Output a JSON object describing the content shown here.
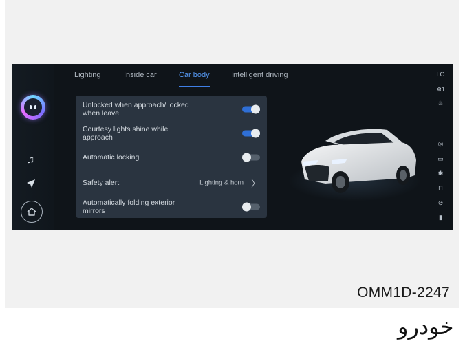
{
  "tabs": [
    {
      "label": "Lighting"
    },
    {
      "label": "Inside car"
    },
    {
      "label": "Car body"
    },
    {
      "label": "Intelligent driving"
    }
  ],
  "settings": [
    {
      "label": "Unlocked when approach/ locked when leave",
      "state": "on"
    },
    {
      "label": "Courtesy lights shine while approach",
      "state": "on"
    },
    {
      "label": "Automatic locking",
      "state": "off"
    },
    {
      "label": "Safety alert",
      "value": "Lighting & horn"
    },
    {
      "label": "Automatically folding exterior mirrors",
      "state": "off"
    }
  ],
  "right_rail": {
    "lo": "LO",
    "fan_speed": "1"
  },
  "colors": {
    "accent": "#3f7fe6",
    "screen_bg": "#0f1419",
    "panel_bg": "#2a3440"
  },
  "caption": "OMM1D-2247",
  "watermark": "خودرو"
}
